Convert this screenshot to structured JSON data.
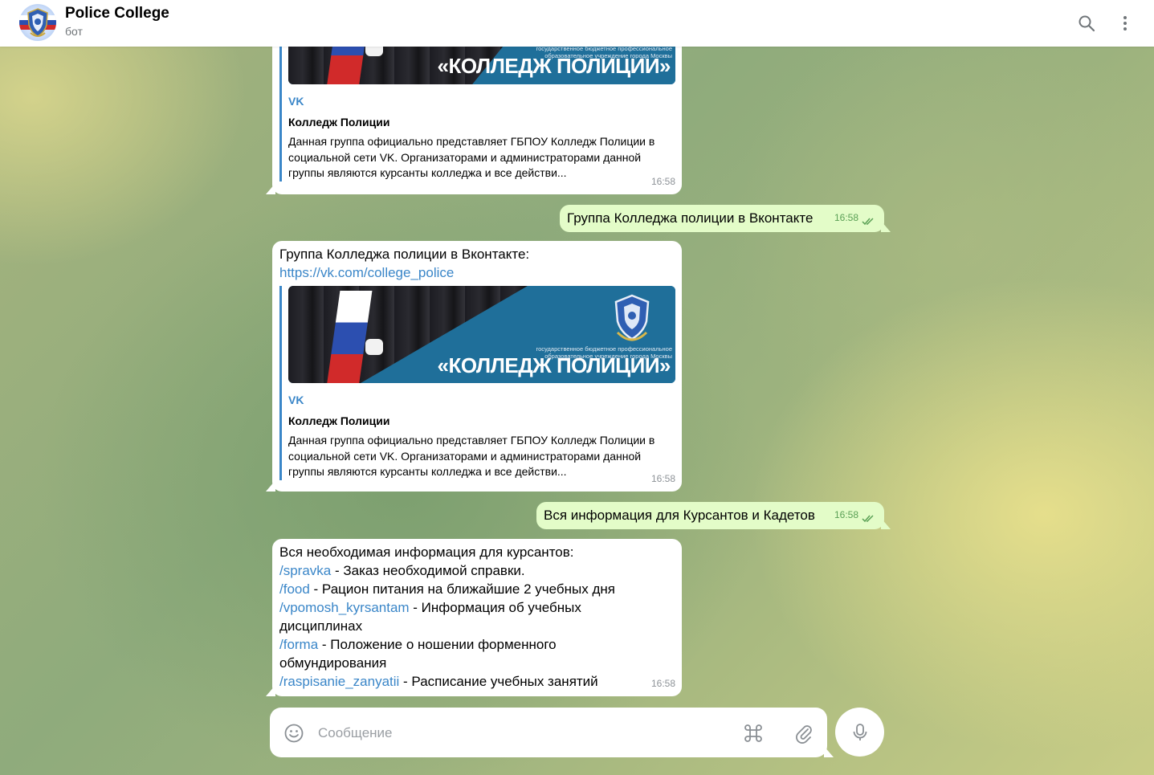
{
  "header": {
    "title": "Police College",
    "subtitle": "бот"
  },
  "preview": {
    "site": "VK",
    "title": "Колледж Полиции",
    "description": "Данная группа официально представляет ГБПОУ Колледж Полиции в социальной сети VK. Организаторами и администраторами данной группы являются курсанты колледжа и все действи...",
    "banner_small_text": "государственное бюджетное профессиональное образовательное учреждение города Москвы",
    "banner_big_text": "«КОЛЛЕДЖ ПОЛИЦИИ»"
  },
  "messages": {
    "m1": {
      "time": "16:58"
    },
    "m2": {
      "text": "Группа Колледжа полиции в Вконтакте",
      "time": "16:58"
    },
    "m3": {
      "text": "Группа Колледжа полиции в Вконтакте:",
      "link": "https://vk.com/college_police",
      "time": "16:58"
    },
    "m4": {
      "text": "Вся информация для Курсантов и Кадетов",
      "time": "16:58"
    },
    "m5": {
      "intro": "Вся необходимая информация для курсантов:",
      "commands": [
        {
          "cmd": "/spravka",
          "desc": " - Заказ необходимой справки."
        },
        {
          "cmd": "/food",
          "desc": " - Рацион питания на ближайшие 2 учебных дня"
        },
        {
          "cmd": "/vpomosh_kyrsantam",
          "desc": " - Информация об учебных дисциплинах"
        },
        {
          "cmd": "/forma",
          "desc": " - Положение о ношении форменного обмундирования"
        },
        {
          "cmd": "/raspisanie_zanyatii",
          "desc": " - Расписание учебных занятий"
        }
      ],
      "time": "16:58"
    }
  },
  "composer": {
    "placeholder": "Сообщение"
  },
  "colors": {
    "accent": "#3a86c8",
    "outgoing_bubble": "#e3fcc8",
    "read_check": "#5aa055"
  }
}
